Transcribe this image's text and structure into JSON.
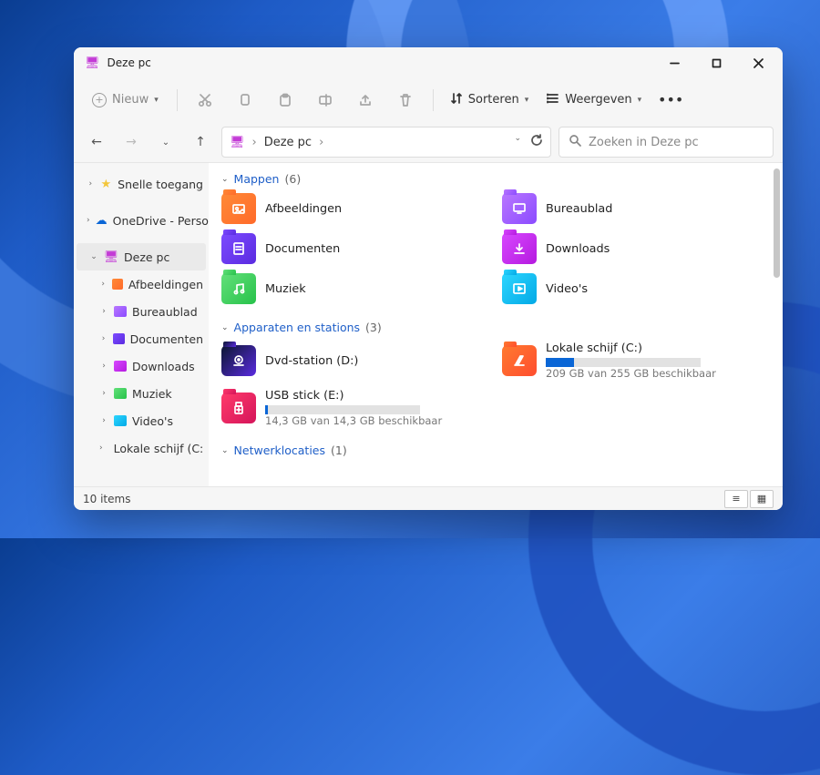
{
  "window": {
    "title": "Deze pc"
  },
  "cmd": {
    "new": "Nieuw",
    "sort": "Sorteren",
    "view": "Weergeven"
  },
  "address": {
    "root": "Deze pc"
  },
  "search": {
    "placeholder": "Zoeken in Deze pc"
  },
  "sidebar": {
    "quick": "Snelle toegang",
    "onedrive": "OneDrive - Perso",
    "thispc": "Deze pc",
    "children": [
      "Afbeeldingen",
      "Bureaublad",
      "Documenten",
      "Downloads",
      "Muziek",
      "Video's",
      "Lokale schijf (C:"
    ]
  },
  "groups": {
    "folders": {
      "label": "Mappen",
      "count": "(6)"
    },
    "devices": {
      "label": "Apparaten en stations",
      "count": "(3)"
    },
    "network": {
      "label": "Netwerklocaties",
      "count": "(1)"
    }
  },
  "folders": [
    {
      "name": "Afbeeldingen"
    },
    {
      "name": "Bureaublad"
    },
    {
      "name": "Documenten"
    },
    {
      "name": "Downloads"
    },
    {
      "name": "Muziek"
    },
    {
      "name": "Video's"
    }
  ],
  "drives": {
    "dvd": {
      "name": "Dvd-station (D:)"
    },
    "c": {
      "name": "Lokale schijf (C:)",
      "sub": "209 GB van 255 GB beschikbaar",
      "fill_pct": 18
    },
    "usb": {
      "name": "USB stick (E:)",
      "sub": "14,3 GB van 14,3 GB beschikbaar",
      "fill_pct": 2
    }
  },
  "status": {
    "items": "10 items"
  }
}
